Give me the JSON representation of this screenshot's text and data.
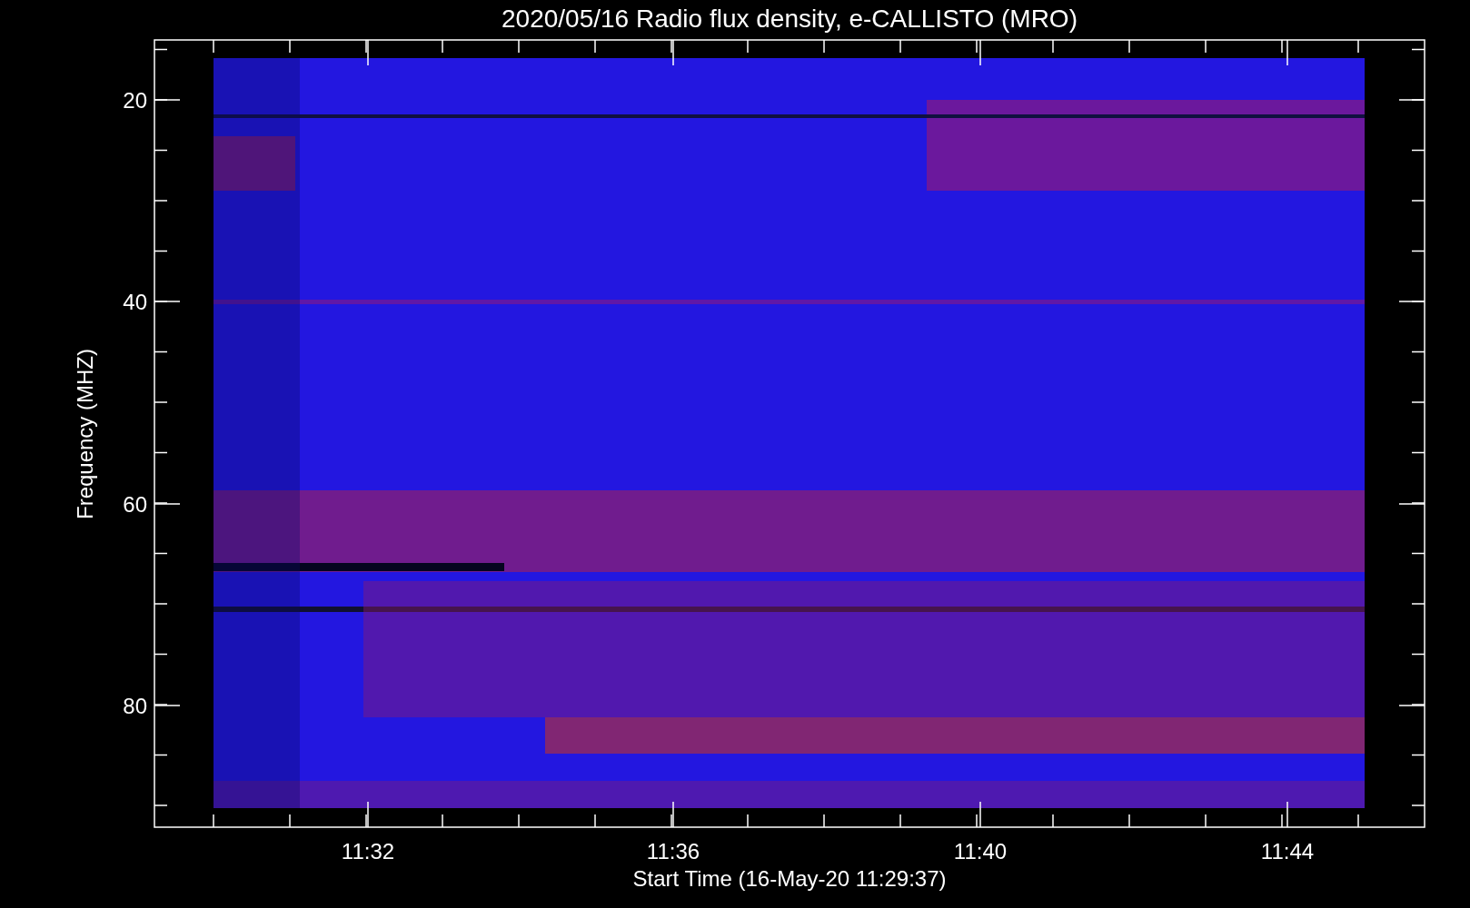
{
  "title": "2020/05/16  Radio flux density, e-CALLISTO (MRO)",
  "y_axis": {
    "label": "Frequency (MHZ)",
    "ticks": [
      "20",
      "40",
      "60",
      "80"
    ]
  },
  "x_axis": {
    "label": "Start Time (16-May-20 11:29:37)",
    "ticks": [
      "11:32",
      "11:36",
      "11:40",
      "11:44"
    ]
  }
}
